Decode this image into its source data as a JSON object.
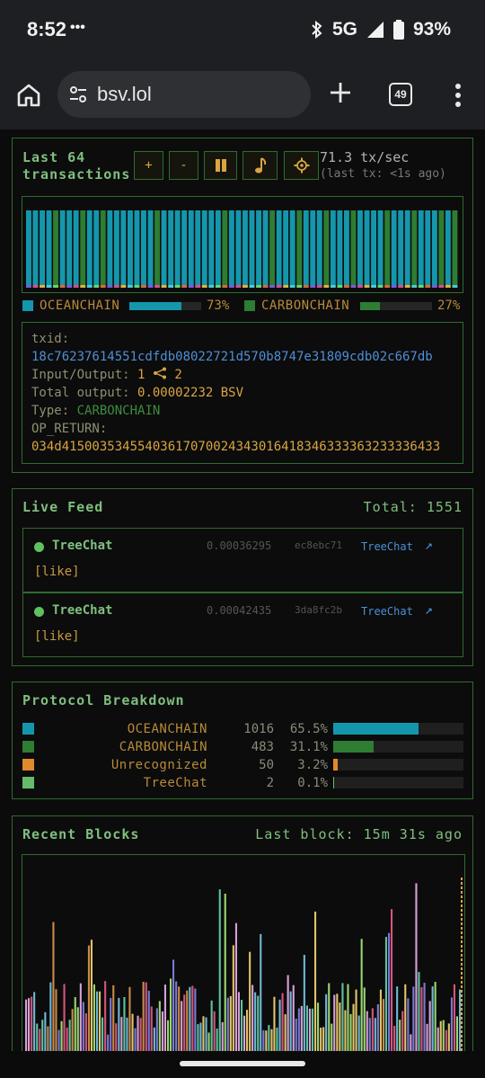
{
  "status": {
    "time": "8:52",
    "dots": "•••",
    "network": "5G",
    "battery": "93%"
  },
  "browser": {
    "url": "bsv.lol",
    "tab_count": "49"
  },
  "tx_panel": {
    "title_line1": "Last 64",
    "title_line2": "transactions",
    "controls": [
      "+",
      "-",
      "pause",
      "music-note",
      "gear"
    ],
    "rate": "71.3 tx/sec",
    "last_tx": "(last tx: <1s ago)",
    "bar_colors": {
      "ocean": "#1497ad",
      "carbon": "#2e7d32"
    },
    "bar_sequence": "OOOOCOOOCOOCOOOOOOOCOOOOOOOOOCOOOOOOCOOOCOOOCOOOCOOOOCOOOCOOOCOC",
    "legend": [
      {
        "name": "OCEANCHAIN",
        "pct": "73%",
        "fraction": 0.73,
        "color": "#1497ad"
      },
      {
        "name": "CARBONCHAIN",
        "pct": "27%",
        "fraction": 0.27,
        "color": "#2e7d32"
      }
    ],
    "detail": {
      "txid_label": "txid:",
      "txid": "18c76237614551cdfdb08022721d570b8747e31809cdb02c667db",
      "io_label": "Input/Output:",
      "inputs": "1",
      "outputs": "2",
      "total_label": "Total output:",
      "total": "0.00002232 BSV",
      "type_label": "Type:",
      "type": "CARBONCHAIN",
      "op_label": "OP_RETURN:",
      "op_return": "034d41500353455403617070024343016418346333363233336433"
    }
  },
  "feed": {
    "title": "Live Feed",
    "total": "Total: 1551",
    "items": [
      {
        "app": "TreeChat",
        "amount": "0.00036295",
        "hash": "ec8ebc71",
        "link": "TreeChat",
        "content": "[like]"
      },
      {
        "app": "TreeChat",
        "amount": "0.00042435",
        "hash": "3da8fc2b",
        "link": "TreeChat",
        "content": "[like]"
      }
    ]
  },
  "protocols": {
    "title": "Protocol Breakdown",
    "rows": [
      {
        "name": "OCEANCHAIN",
        "count": "1016",
        "pct": "65.5%",
        "fraction": 0.655,
        "color": "#1497ad"
      },
      {
        "name": "CARBONCHAIN",
        "count": "483",
        "pct": "31.1%",
        "fraction": 0.311,
        "color": "#2e7d32"
      },
      {
        "name": "Unrecognized",
        "count": "50",
        "pct": "3.2%",
        "fraction": 0.032,
        "color": "#e08a2e"
      },
      {
        "name": "TreeChat",
        "count": "2",
        "pct": "0.1%",
        "fraction": 0.001,
        "color": "#66bb6a"
      }
    ]
  },
  "blocks": {
    "title": "Recent Blocks",
    "last_block": "Last block: 15m 31s ago"
  }
}
